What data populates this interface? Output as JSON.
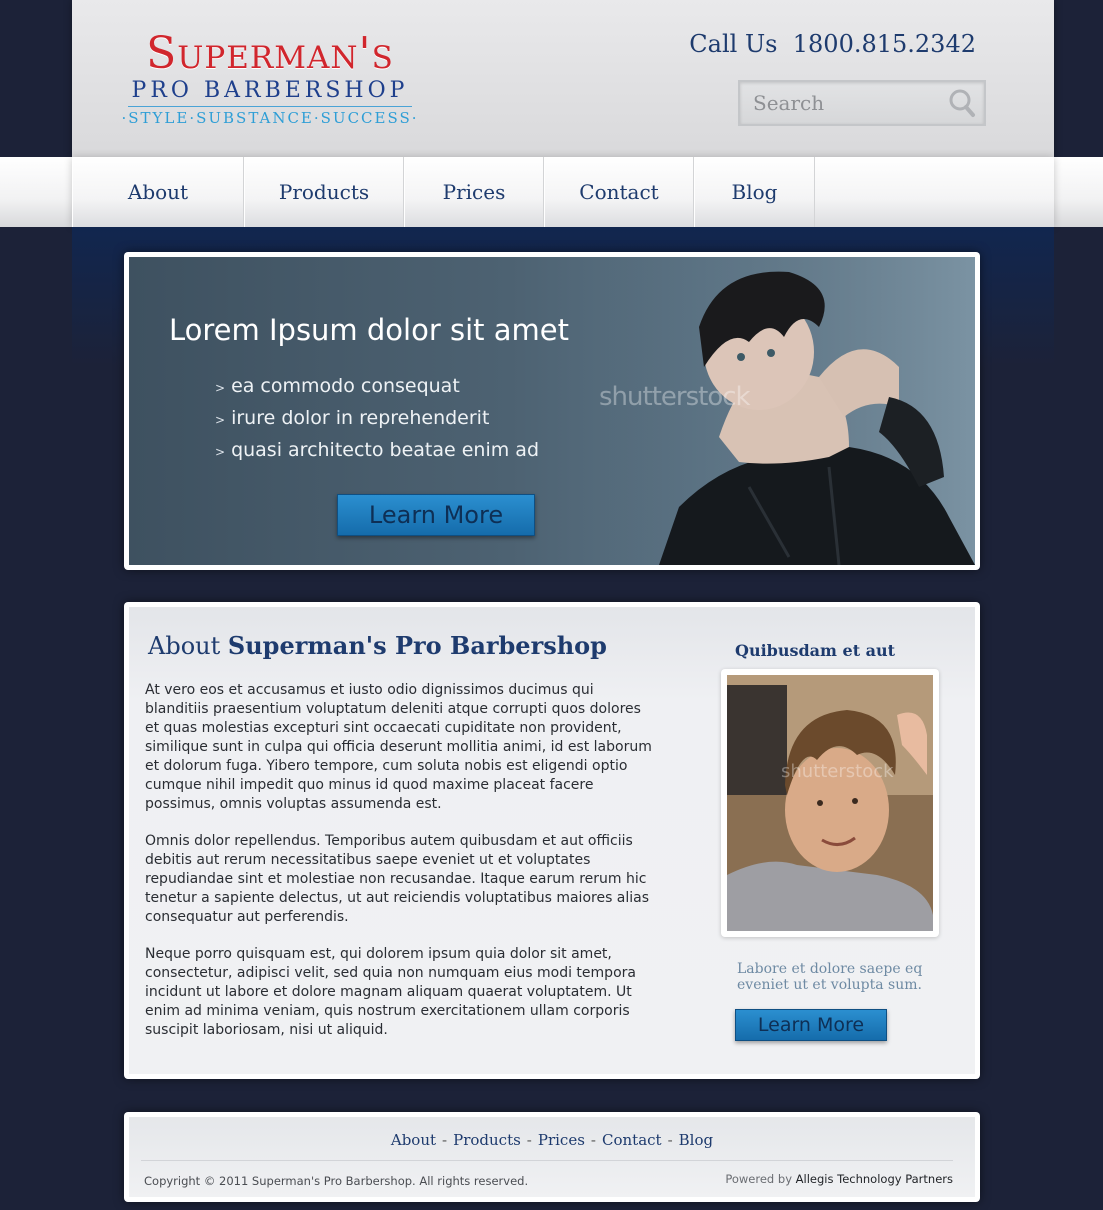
{
  "header": {
    "logo_main": "Superman's",
    "logo_sub": "PRO BARBERSHOP",
    "logo_tagline": "·STYLE·SUBSTANCE·SUCCESS·",
    "call_label": "Call Us",
    "phone": "1800.815.2342",
    "search_placeholder": "Search"
  },
  "nav": {
    "items": [
      {
        "label": "About"
      },
      {
        "label": "Products"
      },
      {
        "label": "Prices"
      },
      {
        "label": "Contact"
      },
      {
        "label": "Blog"
      }
    ]
  },
  "banner": {
    "title": "Lorem Ipsum dolor sit amet",
    "bullets": [
      "ea commodo consequat",
      "irure dolor in reprehenderit",
      "quasi architecto beatae enim ad"
    ],
    "button_label": "Learn More",
    "watermark": "shutterstock"
  },
  "about": {
    "title_prefix": "About",
    "title_bold": "Superman's Pro Barbershop",
    "paragraphs": [
      "At vero eos et accusamus et iusto odio dignissimos ducimus qui blanditiis praesentium voluptatum deleniti atque corrupti quos dolores et quas molestias excepturi sint occaecati cupiditate non provident, similique sunt in culpa qui officia deserunt mollitia animi, id est laborum et dolorum fuga. Yibero tempore, cum soluta nobis est eligendi optio cumque nihil impedit quo minus id quod maxime placeat facere possimus, omnis voluptas assumenda est.",
      "Omnis dolor repellendus. Temporibus autem quibusdam et aut officiis debitis aut rerum necessitatibus saepe eveniet ut et voluptates repudiandae sint et molestiae non recusandae. Itaque earum rerum hic tenetur a sapiente delectus, ut aut reiciendis voluptatibus maiores alias consequatur aut perferendis.",
      "Neque porro quisquam est, qui dolorem ipsum quia dolor sit amet, consectetur, adipisci velit, sed quia non numquam eius modi tempora incidunt ut labore et dolore magnam aliquam quaerat voluptatem. Ut enim ad minima veniam, quis nostrum exercitationem ullam corporis suscipit laboriosam, nisi ut aliquid."
    ]
  },
  "sidebar": {
    "title": "Quibusdam et aut",
    "photo_watermark": "shutterstock",
    "caption": "Labore et dolore saepe eq eveniet ut et volupta sum.",
    "button_label": "Learn More"
  },
  "footer": {
    "links": [
      {
        "label": "About"
      },
      {
        "label": "Products"
      },
      {
        "label": "Prices"
      },
      {
        "label": "Contact"
      },
      {
        "label": "Blog"
      }
    ],
    "separator": "-",
    "copyright": "Copyright © 2011 Superman's Pro Barbershop. All rights reserved.",
    "powered_prefix": "Powered by",
    "powered_company": "Allegis Technology Partners"
  },
  "colors": {
    "background": "#1c2238",
    "brand_red": "#d1262d",
    "brand_navy": "#1e3b6e",
    "accent_blue": "#2e9ed6",
    "button_blue": "#1e7fc0"
  }
}
